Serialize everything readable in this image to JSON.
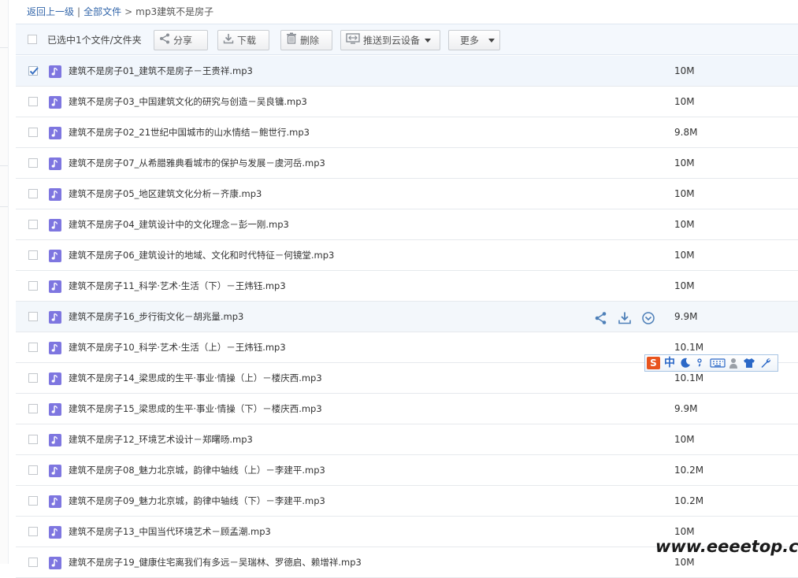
{
  "breadcrumb": {
    "back": "返回上一级",
    "sep1": "|",
    "all_files": "全部文件",
    "sep2": ">",
    "current": "mp3建筑不是房子"
  },
  "toolbar": {
    "selected_text": "已选中1个文件/文件夹",
    "share": "分享",
    "download": "下载",
    "delete": "删除",
    "push": "推送到云设备",
    "more": "更多"
  },
  "files": [
    {
      "name": "建筑不是房子01_建筑不是房子－王贵祥.mp3",
      "size": "10M",
      "checked": true
    },
    {
      "name": "建筑不是房子03_中国建筑文化的研究与创造－吴良镛.mp3",
      "size": "10M",
      "checked": false
    },
    {
      "name": "建筑不是房子02_21世纪中国城市的山水情结－鲍世行.mp3",
      "size": "9.8M",
      "checked": false
    },
    {
      "name": "建筑不是房子07_从希腊雅典看城市的保护与发展－虞河岳.mp3",
      "size": "10M",
      "checked": false
    },
    {
      "name": "建筑不是房子05_地区建筑文化分析－齐康.mp3",
      "size": "10M",
      "checked": false
    },
    {
      "name": "建筑不是房子04_建筑设计中的文化理念－彭一刚.mp3",
      "size": "10M",
      "checked": false
    },
    {
      "name": "建筑不是房子06_建筑设计的地域、文化和时代特征－何镜堂.mp3",
      "size": "10M",
      "checked": false
    },
    {
      "name": "建筑不是房子11_科学·艺术·生活（下）－王炜钰.mp3",
      "size": "10M",
      "checked": false
    },
    {
      "name": "建筑不是房子16_步行街文化－胡兆量.mp3",
      "size": "9.9M",
      "checked": false
    },
    {
      "name": "建筑不是房子10_科学·艺术·生活（上）－王炜钰.mp3",
      "size": "10.1M",
      "checked": false
    },
    {
      "name": "建筑不是房子14_梁思成的生平·事业·情操（上）－楼庆西.mp3",
      "size": "10.1M",
      "checked": false
    },
    {
      "name": "建筑不是房子15_梁思成的生平·事业·情操（下）－楼庆西.mp3",
      "size": "9.9M",
      "checked": false
    },
    {
      "name": "建筑不是房子12_环境艺术设计－郑曙旸.mp3",
      "size": "10M",
      "checked": false
    },
    {
      "name": "建筑不是房子08_魅力北京城，韵律中轴线（上）－李建平.mp3",
      "size": "10.2M",
      "checked": false
    },
    {
      "name": "建筑不是房子09_魅力北京城，韵律中轴线（下）－李建平.mp3",
      "size": "10.2M",
      "checked": false
    },
    {
      "name": "建筑不是房子13_中国当代环境艺术－顾孟潮.mp3",
      "size": "10M",
      "checked": false
    },
    {
      "name": "建筑不是房子19_健康住宅离我们有多远－吴瑞林、罗德启、赖增祥.mp3",
      "size": "10M",
      "checked": false
    }
  ],
  "hover_row": 8,
  "ime": {
    "logo": "S",
    "mode": "中"
  },
  "watermark": "www.eeeetop.com",
  "colors": {
    "accent": "#3366aa",
    "audio_icon": "#7e76e0",
    "action_icon": "#4d7fb8"
  }
}
